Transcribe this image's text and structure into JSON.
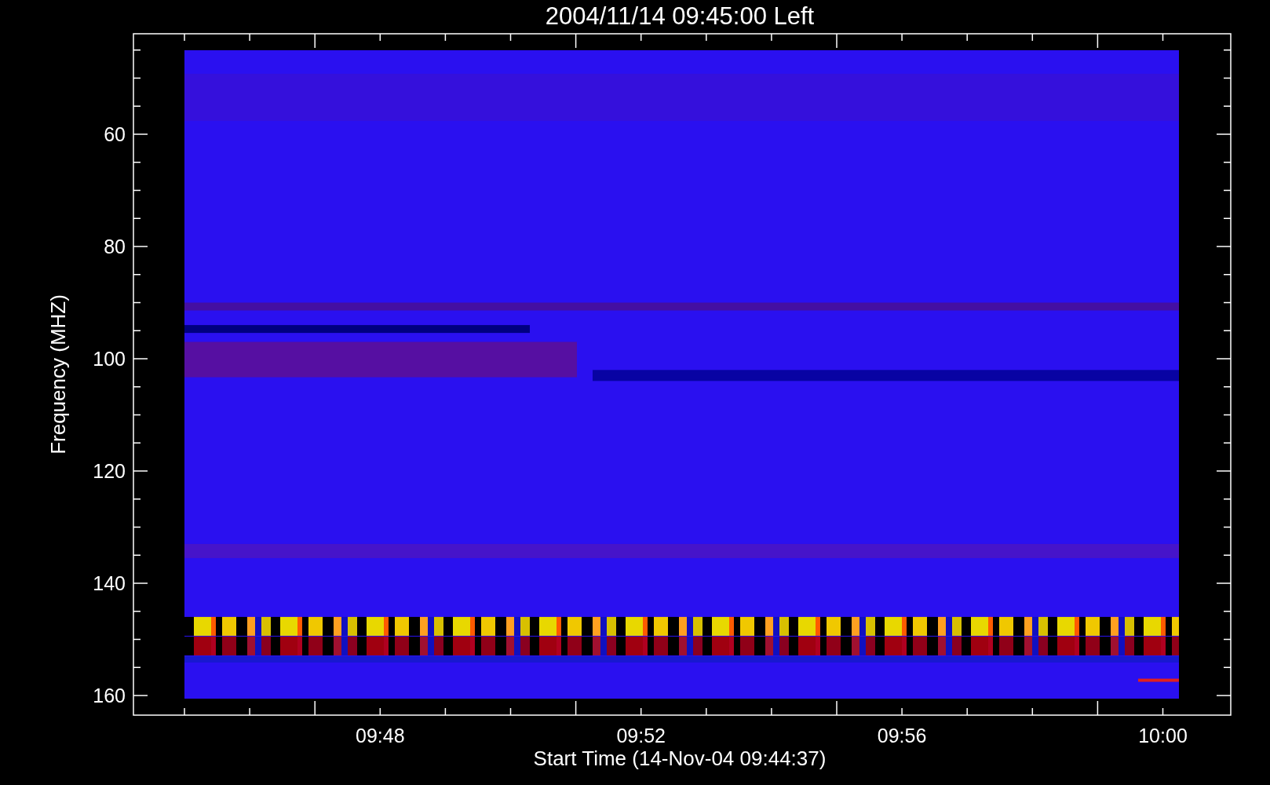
{
  "plot": {
    "title": "2004/11/14 09:45:00 Left",
    "ylabel": "Frequency (MHZ)",
    "xlabel": "Start Time (14-Nov-04 09:44:37)",
    "yticks": [
      "60",
      "80",
      "100",
      "120",
      "140",
      "160"
    ],
    "xticks": [
      "09:48",
      "09:52",
      "09:56",
      "10:00"
    ]
  }
}
